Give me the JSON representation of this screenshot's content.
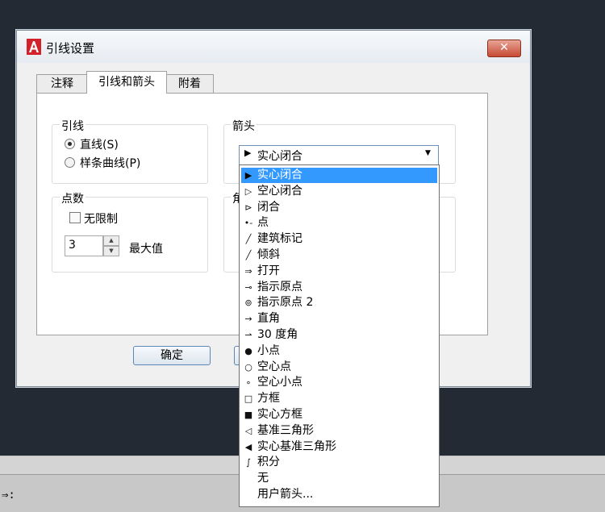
{
  "dialog": {
    "title": "引线设置",
    "close_label": "✕",
    "tabs": [
      {
        "label": "注释",
        "active": false
      },
      {
        "label": "引线和箭头",
        "active": true
      },
      {
        "label": "附着",
        "active": false
      }
    ],
    "leader_group": {
      "title": "引线",
      "options": [
        {
          "label": "直线(S)",
          "checked": true
        },
        {
          "label": "样条曲线(P)",
          "checked": false
        }
      ]
    },
    "arrow_group": {
      "title": "箭头",
      "selected": "实心闭合"
    },
    "points_group": {
      "title": "点数",
      "no_limit_label": "无限制",
      "no_limit_checked": false,
      "max_value": "3",
      "max_label": "最大值"
    },
    "angle_group": {
      "title_partial": "角"
    },
    "ok_label": "确定"
  },
  "dropdown": {
    "items": [
      {
        "label": "实心闭合",
        "icon": "▶",
        "icon_name": "solid-closed-arrow-icon",
        "selected": true
      },
      {
        "label": "空心闭合",
        "icon": "▷",
        "icon_name": "hollow-closed-arrow-icon"
      },
      {
        "label": "闭合",
        "icon": "⊳",
        "icon_name": "closed-arrow-icon"
      },
      {
        "label": "点",
        "icon": "•-",
        "icon_name": "dot-icon"
      },
      {
        "label": "建筑标记",
        "icon": "╱",
        "icon_name": "architectural-tick-icon"
      },
      {
        "label": "倾斜",
        "icon": "╱",
        "icon_name": "oblique-icon"
      },
      {
        "label": "打开",
        "icon": "⇒",
        "icon_name": "open-arrow-icon"
      },
      {
        "label": "指示原点",
        "icon": "⊸",
        "icon_name": "origin-indicator-icon"
      },
      {
        "label": "指示原点 2",
        "icon": "⊚",
        "icon_name": "origin-indicator-2-icon"
      },
      {
        "label": "直角",
        "icon": "→",
        "icon_name": "right-angle-icon"
      },
      {
        "label": "30 度角",
        "icon": "⇀",
        "icon_name": "open-30-icon"
      },
      {
        "label": "小点",
        "icon": "●",
        "icon_name": "dot-small-icon"
      },
      {
        "label": "空心点",
        "icon": "○",
        "icon_name": "dot-blank-icon"
      },
      {
        "label": "空心小点",
        "icon": "∘",
        "icon_name": "dot-small-blank-icon"
      },
      {
        "label": "方框",
        "icon": "□",
        "icon_name": "box-blank-icon"
      },
      {
        "label": "实心方框",
        "icon": "■",
        "icon_name": "box-filled-icon"
      },
      {
        "label": "基准三角形",
        "icon": "◁",
        "icon_name": "datum-triangle-icon"
      },
      {
        "label": "实心基准三角形",
        "icon": "◀",
        "icon_name": "datum-triangle-filled-icon"
      },
      {
        "label": "积分",
        "icon": "∫",
        "icon_name": "integral-icon"
      },
      {
        "label": "无",
        "icon": "",
        "icon_name": "none-icon"
      },
      {
        "label": "用户箭头...",
        "icon": "",
        "icon_name": "user-arrow-icon"
      }
    ]
  },
  "command_line": {
    "prompt": "⇒:"
  },
  "colors": {
    "background": "#232a33",
    "selection": "#3399ff",
    "close_button": "#c74a34"
  }
}
